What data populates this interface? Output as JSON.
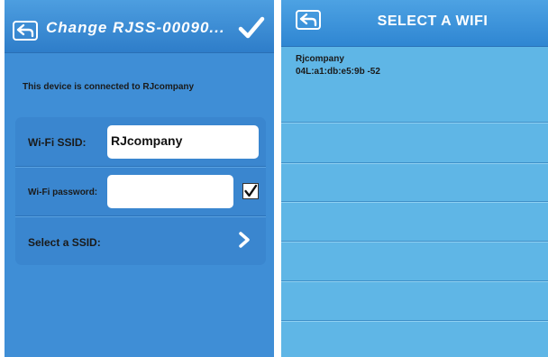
{
  "left_screen": {
    "header": {
      "title": "Change RJSS-00090...",
      "back_icon": "back-arrow-icon",
      "confirm_icon": "checkmark-icon"
    },
    "connection_message": "This device is connected to RJcompany",
    "form": {
      "ssid_label": "Wi-Fi SSID:",
      "ssid_value": "RJcompany",
      "password_label": "Wi-Fi password:",
      "password_value": "",
      "show_password_checked": true,
      "select_ssid_label": "Select a SSID:",
      "select_ssid_icon": "chevron-right-icon"
    }
  },
  "right_screen": {
    "header": {
      "title": "SELECT A WIFI",
      "back_icon": "back-arrow-icon"
    },
    "networks": [
      {
        "name": "Rjcompany",
        "info": "04L:a1:db:e5:9b -52"
      }
    ]
  },
  "colors": {
    "left_background": "#3f8ed6",
    "right_background": "#5fb6e6",
    "header_blue": "#2e7dc9",
    "card_blue": "#3a86cf"
  }
}
